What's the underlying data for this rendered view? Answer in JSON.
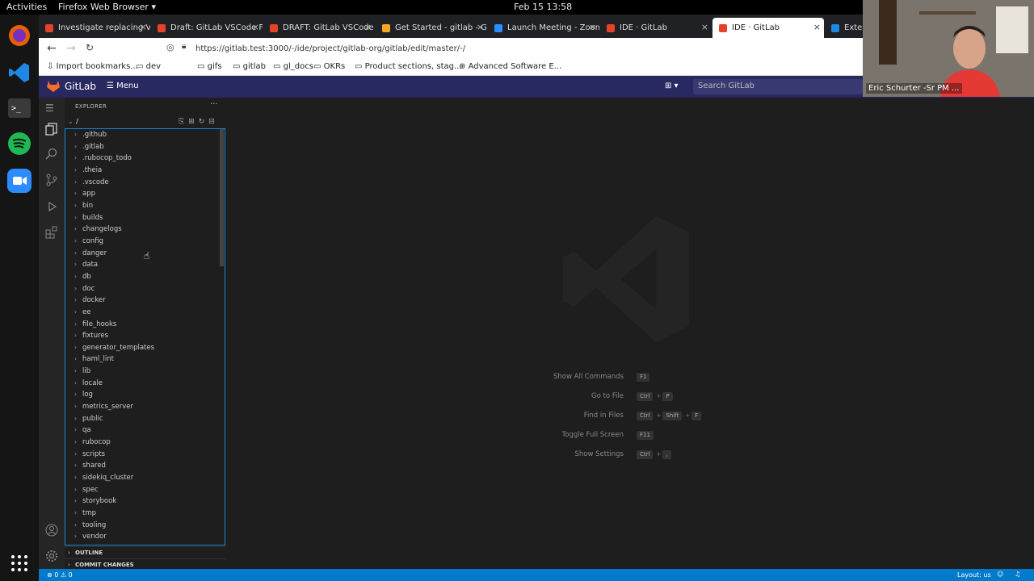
{
  "system": {
    "activities": "Activities",
    "app_menu": "Firefox Web Browser ▾",
    "clock": "Feb 15  13:58"
  },
  "dock": [
    {
      "name": "firefox-icon",
      "color": "#e66000"
    },
    {
      "name": "vscode-icon",
      "color": "#1e88e5"
    },
    {
      "name": "terminal-icon",
      "color": "#333333"
    },
    {
      "name": "spotify-icon",
      "color": "#1db954"
    },
    {
      "name": "zoom-icon",
      "color": "#2d8cff"
    },
    {
      "name": "app-grid-icon",
      "color": "#ffffff"
    }
  ],
  "tabs": [
    {
      "label": "Investigate replacing V",
      "color": "#e24329"
    },
    {
      "label": "Draft: GitLab VSCode F",
      "color": "#e24329"
    },
    {
      "label": "DRAFT: GitLab VSCode",
      "color": "#e24329"
    },
    {
      "label": "Get Started - gitlab - Gi",
      "color": "#f5a623"
    },
    {
      "label": "Launch Meeting - Zoom",
      "color": "#2d8cff"
    },
    {
      "label": "IDE · GitLab",
      "color": "#e24329"
    },
    {
      "label": "IDE · GitLab",
      "color": "#e24329"
    },
    {
      "label": "Exten",
      "color": "#1e88e5"
    }
  ],
  "url": "https://gitlab.test:3000/-/ide/project/gitlab-org/gitlab/edit/master/-/",
  "bookmarks": [
    "Import bookmarks...",
    "dev",
    "gifs",
    "gitlab",
    "gl_docs",
    "OKRs",
    "Product sections, stag...",
    "Advanced Software E..."
  ],
  "gitlab": {
    "brand": "GitLab",
    "menu": "Menu",
    "search_placeholder": "Search GitLab",
    "brand_color": "#292961"
  },
  "webcam": {
    "name": "Eric Schurter -Sr PM ..."
  },
  "explorer": {
    "title": "EXPLORER",
    "more": "···",
    "root": "/",
    "folders": [
      ".github",
      ".gitlab",
      ".rubocop_todo",
      ".theia",
      ".vscode",
      "app",
      "bin",
      "builds",
      "changelogs",
      "config",
      "danger",
      "data",
      "db",
      "doc",
      "docker",
      "ee",
      "file_hooks",
      "fixtures",
      "generator_templates",
      "haml_lint",
      "lib",
      "locale",
      "log",
      "metrics_server",
      "public",
      "qa",
      "rubocop",
      "scripts",
      "shared",
      "sidekiq_cluster",
      "spec",
      "storybook",
      "tmp",
      "tooling",
      "vendor"
    ],
    "outline": "OUTLINE",
    "commit": "COMMIT CHANGES"
  },
  "commands": [
    {
      "label": "Show All Commands",
      "keys": [
        "F1"
      ]
    },
    {
      "label": "Go to File",
      "keys": [
        "Ctrl",
        "P"
      ]
    },
    {
      "label": "Find in Files",
      "keys": [
        "Ctrl",
        "Shift",
        "F"
      ]
    },
    {
      "label": "Toggle Full Screen",
      "keys": [
        "F11"
      ]
    },
    {
      "label": "Show Settings",
      "keys": [
        "Ctrl",
        ","
      ]
    }
  ],
  "statusbar": {
    "problems": "⊗ 0 ⚠ 0",
    "layout": "Layout: us"
  }
}
